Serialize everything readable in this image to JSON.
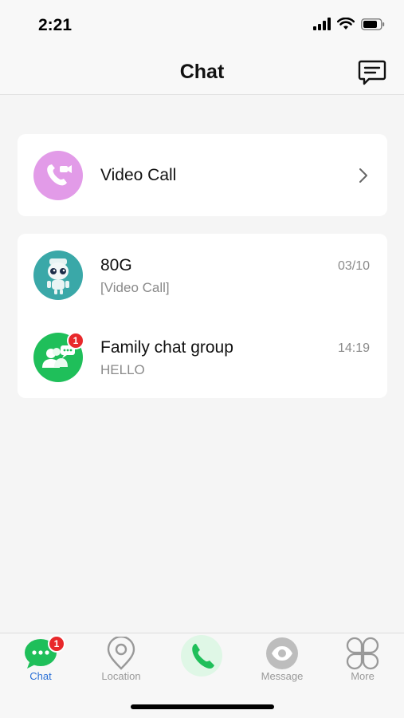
{
  "status_bar": {
    "time": "2:21"
  },
  "nav": {
    "title": "Chat"
  },
  "video_call": {
    "label": "Video Call"
  },
  "chats": [
    {
      "name": "80G",
      "preview": "[Video Call]",
      "time": "03/10"
    },
    {
      "name": "Family chat group",
      "preview": "HELLO",
      "time": "14:19",
      "badge": "1"
    }
  ],
  "tabs": [
    {
      "label": "Chat",
      "badge": "1",
      "active": true
    },
    {
      "label": "Location"
    },
    {
      "label": ""
    },
    {
      "label": "Message"
    },
    {
      "label": "More"
    }
  ],
  "colors": {
    "accent_green": "#1fbf5a",
    "video_purple": "#e29be8",
    "badge_red": "#e8282b",
    "active_blue": "#2a6fd6"
  }
}
